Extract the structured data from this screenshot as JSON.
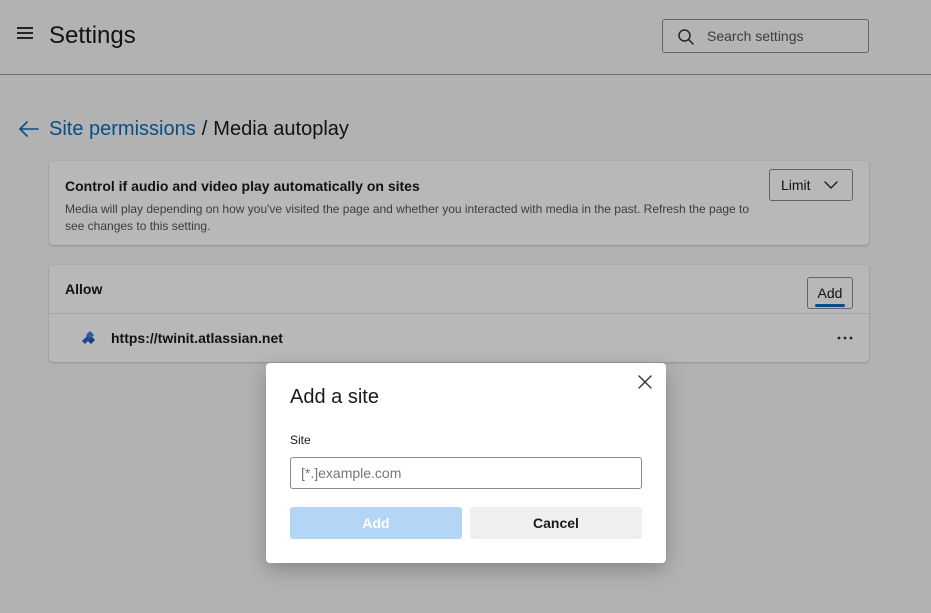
{
  "header": {
    "title": "Settings",
    "search_placeholder": "Search settings"
  },
  "breadcrumb": {
    "parent": "Site permissions",
    "separator": "/",
    "current": "Media autoplay"
  },
  "autoplay_card": {
    "title": "Control if audio and video play automatically on sites",
    "description": "Media will play depending on how you've visited the page and whether you interacted with media in the past. Refresh the page to see changes to this setting.",
    "dropdown_value": "Limit"
  },
  "allow_card": {
    "title": "Allow",
    "add_label": "Add",
    "sites": [
      {
        "url": "https://twinit.atlassian.net",
        "icon": "atlassian-site-icon"
      }
    ]
  },
  "dialog": {
    "title": "Add a site",
    "field_label": "Site",
    "field_placeholder": "[*.]example.com",
    "field_value": "",
    "add_label": "Add",
    "cancel_label": "Cancel"
  },
  "colors": {
    "accent": "#0f6cbd",
    "disabled_primary": "#b4d6f6",
    "overlay": "rgba(0,0,0,0.28)"
  }
}
